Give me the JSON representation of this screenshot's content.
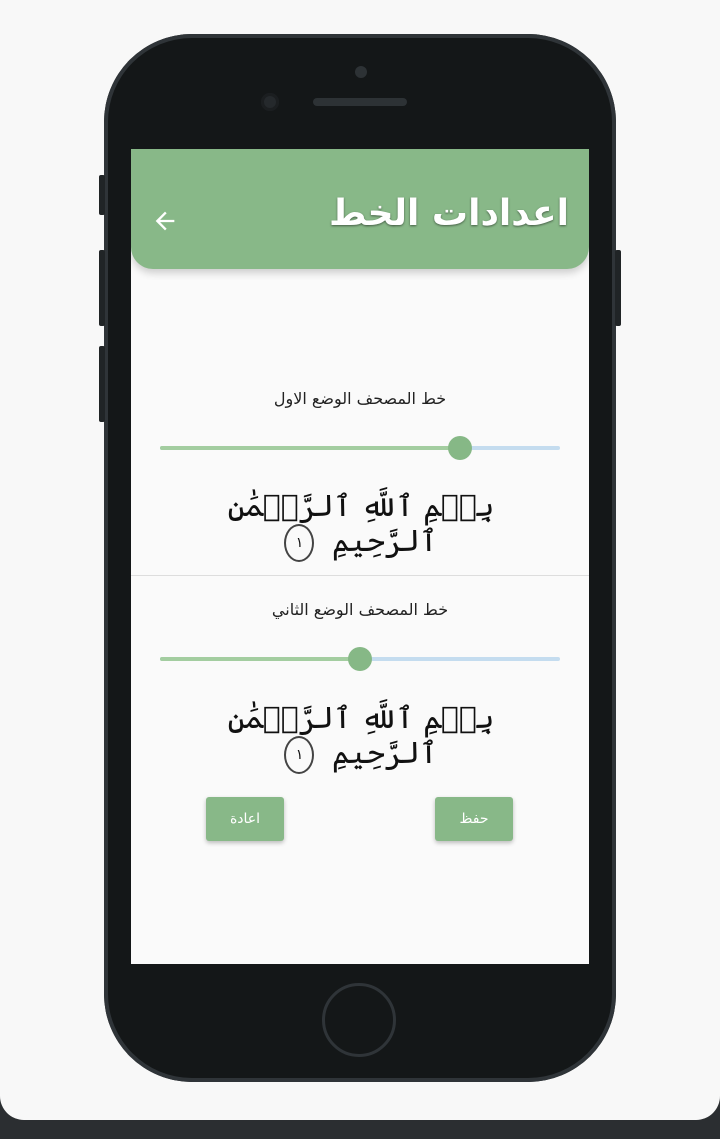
{
  "app_bar": {
    "title": "اعدادات الخط",
    "back_icon": "arrow-left-icon",
    "color": "#88b888"
  },
  "settings": [
    {
      "label": "خط المصحف الوضع الاول",
      "slider_value": 0.75,
      "preview_text": "بِسۡمِ ٱللَّهِ ٱلرَّحۡمَٰنِ ٱلرَّحِيمِ",
      "ayah_number": "١"
    },
    {
      "label": "خط المصحف الوضع الثاني",
      "slider_value": 0.5,
      "preview_text": "بِسۡمِ ٱللَّهِ ٱلرَّحۡمَٰنِ ٱلرَّحِيمِ",
      "ayah_number": "١"
    }
  ],
  "buttons": {
    "save_label": "حفظ",
    "reset_label": "اعادة"
  },
  "colors": {
    "accent": "#88b888",
    "slider_inactive": "#c4dcef"
  }
}
